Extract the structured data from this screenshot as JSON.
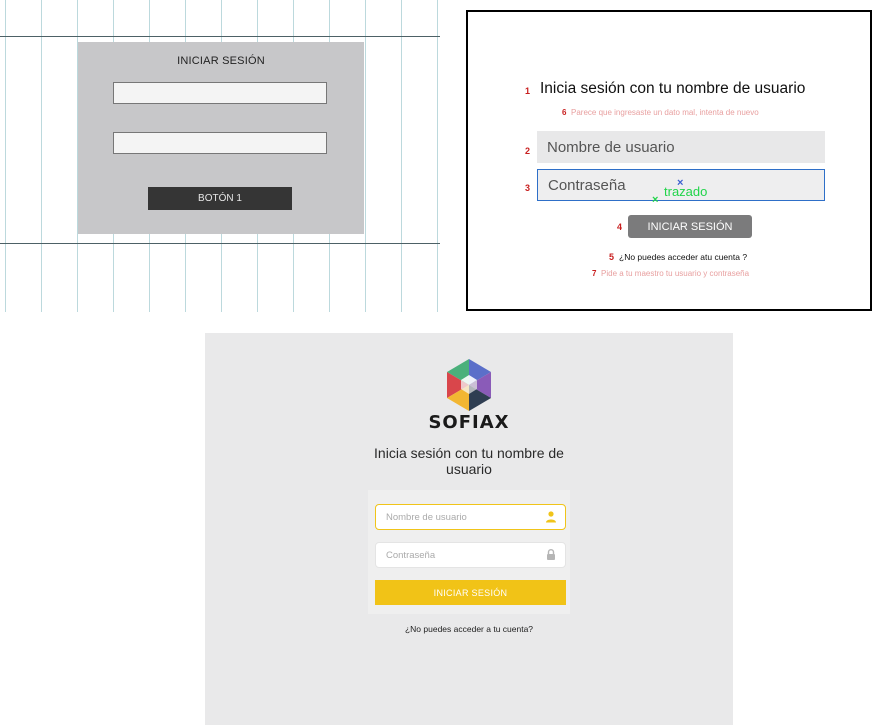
{
  "wireframe": {
    "title": "INICIAR SESIÓN",
    "button_label": "BOTÓN 1"
  },
  "mockup": {
    "title": "Inicia sesión con tu nombre de usuario",
    "error": "Parece que ingresaste un dato mal, intenta de nuevo",
    "username_placeholder": "Nombre de usuario",
    "password_placeholder": "Contraseña",
    "trace_label": "trazado",
    "button_label": "INICIAR SESIÓN",
    "no_access": "¿No puedes acceder atu cuenta ?",
    "hint": "Pide a tu maestro tu usuario y contraseña",
    "numbers": {
      "title": "1",
      "username": "2",
      "password": "3",
      "button": "4",
      "no_access": "5",
      "error": "6",
      "hint": "7"
    },
    "colors": {
      "annotation": "#c81e1e",
      "trace": "#21d44a",
      "focus_border": "#2e6fc8"
    }
  },
  "final": {
    "brand": "SOFIAX",
    "title": "Inicia sesión con tu nombre de usuario",
    "username_placeholder": "Nombre de usuario",
    "password_placeholder": "Contraseña",
    "button_label": "INICIAR SESIÓN",
    "no_access": "¿No puedes acceder a tu cuenta?",
    "icons": {
      "username": "user-icon",
      "password": "lock-icon"
    },
    "colors": {
      "accent": "#f1c317"
    }
  }
}
